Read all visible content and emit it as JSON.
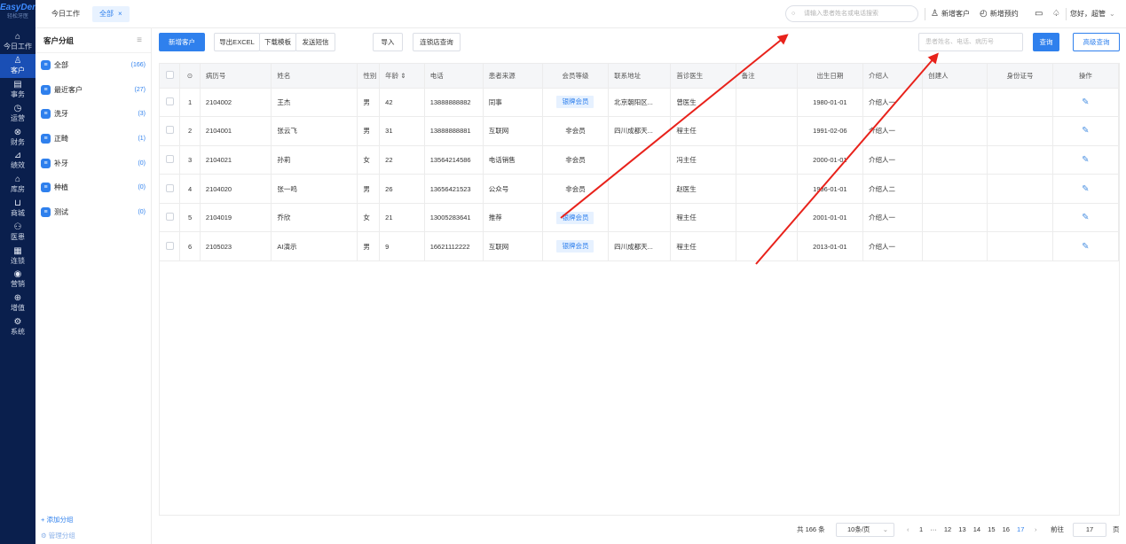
{
  "app": {
    "logo": "EasyDent",
    "logo_sub": "轻松牙医"
  },
  "nav": [
    {
      "label": "今日工作",
      "icon": "home-icon",
      "glyph": "⌂"
    },
    {
      "label": "客户",
      "icon": "user-icon",
      "glyph": "♙"
    },
    {
      "label": "事务",
      "icon": "task-icon",
      "glyph": "▤"
    },
    {
      "label": "运营",
      "icon": "clock-icon",
      "glyph": "◷"
    },
    {
      "label": "财务",
      "icon": "finance-icon",
      "glyph": "⊗"
    },
    {
      "label": "绩效",
      "icon": "chart-icon",
      "glyph": "⊿"
    },
    {
      "label": "库房",
      "icon": "warehouse-icon",
      "glyph": "⌂"
    },
    {
      "label": "商城",
      "icon": "cart-icon",
      "glyph": "⊔"
    },
    {
      "label": "医患",
      "icon": "doctor-icon",
      "glyph": "⚇"
    },
    {
      "label": "连锁",
      "icon": "chain-icon",
      "glyph": "▦"
    },
    {
      "label": "营销",
      "icon": "marketing-icon",
      "glyph": "◉"
    },
    {
      "label": "增值",
      "icon": "value-icon",
      "glyph": "⊕"
    },
    {
      "label": "系统",
      "icon": "gear-icon",
      "glyph": "⚙"
    }
  ],
  "topbar": {
    "tab_home": "今日工作",
    "tab_all": "全部",
    "tab_close": "×",
    "search_placeholder": "请输入患者姓名或电话搜索",
    "add_customer": "新增客户",
    "add_appointment": "新增预约",
    "greeting": "您好，超管"
  },
  "groups": {
    "title": "客户分组",
    "items": [
      {
        "label": "全部",
        "count": "(166)"
      },
      {
        "label": "最近客户",
        "count": "(27)"
      },
      {
        "label": "洗牙",
        "count": "(3)"
      },
      {
        "label": "正畸",
        "count": "(1)"
      },
      {
        "label": "补牙",
        "count": "(0)"
      },
      {
        "label": "种植",
        "count": "(0)"
      },
      {
        "label": "测试",
        "count": "(0)"
      }
    ],
    "add": "+ 添加分组",
    "manage": "⚙ 管理分组"
  },
  "toolbar": {
    "new_customer": "新增客户",
    "export_excel": "导出EXCEL",
    "download_template": "下载模板",
    "send_sms": "发送短信",
    "import": "导入",
    "chain_query": "连锁店查询",
    "search_placeholder": "患者姓名、电话、病历号",
    "query": "查询",
    "advanced_query": "高级查询"
  },
  "table": {
    "headers": {
      "record": "病历号",
      "name": "姓名",
      "gender": "性别",
      "age": "年龄 ⇕",
      "phone": "电话",
      "source": "患者来源",
      "level": "会员等级",
      "address": "联系地址",
      "doctor": "首诊医生",
      "remark": "备注",
      "birth": "出生日期",
      "referrer": "介绍人",
      "creator": "创建人",
      "idcard": "身份证号",
      "action": "操作"
    },
    "rows": [
      {
        "no": "1",
        "record": "2104002",
        "name": "王杰",
        "gender": "男",
        "age": "42",
        "phone": "13888888882",
        "source": "同事",
        "level": "银牌会员",
        "badge": true,
        "address": "北京朝阳区...",
        "doctor": "曾医生",
        "birth": "1980-01-01",
        "referrer": "介绍人一"
      },
      {
        "no": "2",
        "record": "2104001",
        "name": "张云飞",
        "gender": "男",
        "age": "31",
        "phone": "13888888881",
        "source": "互联网",
        "level": "非会员",
        "badge": false,
        "address": "四川成都天...",
        "doctor": "程主任",
        "birth": "1991-02-06",
        "referrer": "介绍人一"
      },
      {
        "no": "3",
        "record": "2104021",
        "name": "孙莉",
        "gender": "女",
        "age": "22",
        "phone": "13564214586",
        "source": "电话销售",
        "level": "非会员",
        "badge": false,
        "address": "",
        "doctor": "冯主任",
        "birth": "2000-01-01",
        "referrer": "介绍人一"
      },
      {
        "no": "4",
        "record": "2104020",
        "name": "张一鸣",
        "gender": "男",
        "age": "26",
        "phone": "13656421523",
        "source": "公众号",
        "level": "非会员",
        "badge": false,
        "address": "",
        "doctor": "赵医生",
        "birth": "1996-01-01",
        "referrer": "介绍人二"
      },
      {
        "no": "5",
        "record": "2104019",
        "name": "乔欣",
        "gender": "女",
        "age": "21",
        "phone": "13005283641",
        "source": "推荐",
        "level": "银牌会员",
        "badge": true,
        "address": "",
        "doctor": "程主任",
        "birth": "2001-01-01",
        "referrer": "介绍人一"
      },
      {
        "no": "6",
        "record": "2105023",
        "name": "AI演示",
        "gender": "男",
        "age": "9",
        "phone": "16621112222",
        "source": "互联网",
        "level": "银牌会员",
        "badge": true,
        "address": "四川成都天...",
        "doctor": "程主任",
        "birth": "2013-01-01",
        "referrer": "介绍人一"
      }
    ]
  },
  "pager": {
    "total": "共 166 条",
    "size": "10条/页",
    "prev": "‹",
    "next": "›",
    "ellipsis": "···",
    "pages": [
      "1",
      "12",
      "13",
      "14",
      "15",
      "16",
      "17"
    ],
    "active": "17",
    "goto": "前往",
    "goto_value": "17",
    "page_unit": "页"
  },
  "colors": {
    "accent": "#2f80ed",
    "sidebar": "#0a1f4d",
    "arrow": "#e8221b"
  }
}
